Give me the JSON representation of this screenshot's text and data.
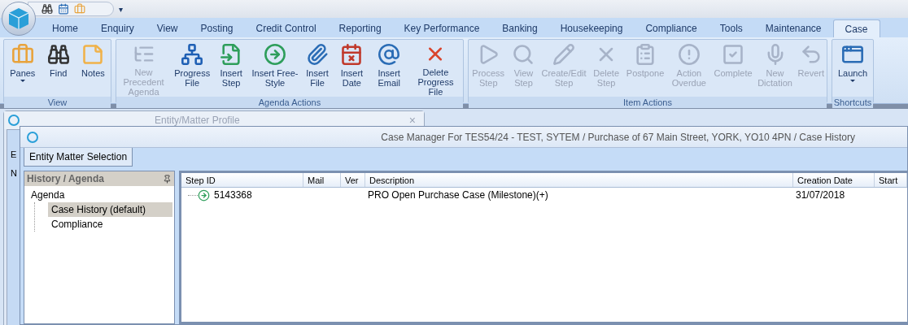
{
  "quick_access": {
    "menu_glyph": "▾"
  },
  "tabs": [
    {
      "label": "Home",
      "selected": false
    },
    {
      "label": "Enquiry",
      "selected": false
    },
    {
      "label": "View",
      "selected": false
    },
    {
      "label": "Posting",
      "selected": false
    },
    {
      "label": "Credit Control",
      "selected": false
    },
    {
      "label": "Reporting",
      "selected": false
    },
    {
      "label": "Key Performance",
      "selected": false
    },
    {
      "label": "Banking",
      "selected": false
    },
    {
      "label": "Housekeeping",
      "selected": false
    },
    {
      "label": "Compliance",
      "selected": false
    },
    {
      "label": "Tools",
      "selected": false
    },
    {
      "label": "Maintenance",
      "selected": false
    },
    {
      "label": "Case",
      "selected": true
    }
  ],
  "ribbon_groups": [
    {
      "title": "View",
      "buttons": [
        {
          "label": "Panes",
          "disabled": false,
          "dropdown": true
        },
        {
          "label": "Find",
          "disabled": false,
          "dropdown": false
        },
        {
          "label": "Notes",
          "disabled": false,
          "dropdown": false
        }
      ]
    },
    {
      "title": "Agenda Actions",
      "buttons": [
        {
          "label": "New Precedent Agenda",
          "disabled": true,
          "dropdown": false
        },
        {
          "label": "Progress File",
          "disabled": false,
          "dropdown": false
        },
        {
          "label": "Insert Step",
          "disabled": false,
          "dropdown": false
        },
        {
          "label": "Insert Free-Style",
          "disabled": false,
          "dropdown": false
        },
        {
          "label": "Insert File",
          "disabled": false,
          "dropdown": false
        },
        {
          "label": "Insert Date",
          "disabled": false,
          "dropdown": false
        },
        {
          "label": "Insert Email",
          "disabled": false,
          "dropdown": false
        },
        {
          "label": "Delete Progress File",
          "disabled": false,
          "dropdown": false
        }
      ]
    },
    {
      "title": "Item Actions",
      "buttons": [
        {
          "label": "Process Step",
          "disabled": true,
          "dropdown": false
        },
        {
          "label": "View Step",
          "disabled": true,
          "dropdown": false
        },
        {
          "label": "Create/Edit Step",
          "disabled": true,
          "dropdown": false
        },
        {
          "label": "Delete Step",
          "disabled": true,
          "dropdown": false
        },
        {
          "label": "Postpone",
          "disabled": true,
          "dropdown": false
        },
        {
          "label": "Action Overdue",
          "disabled": true,
          "dropdown": false
        },
        {
          "label": "Complete",
          "disabled": true,
          "dropdown": false
        },
        {
          "label": "New Dictation",
          "disabled": true,
          "dropdown": false
        },
        {
          "label": "Revert",
          "disabled": true,
          "dropdown": false
        }
      ]
    },
    {
      "title": "Shortcuts",
      "buttons": [
        {
          "label": "Launch",
          "disabled": false,
          "dropdown": true
        }
      ]
    }
  ],
  "background_window": {
    "title": "Entity/Matter Profile",
    "close_glyph": "×",
    "labels": [
      "E",
      "N"
    ]
  },
  "case_window": {
    "title": "Case Manager For TES54/24 - TEST, SYTEM / Purchase of 67 Main Street, YORK, YO10 4PN / Case History",
    "toolbar_button": "Entity Matter Selection",
    "pane": {
      "title": "History / Agenda",
      "tree": [
        {
          "label": "Agenda",
          "selected": false,
          "children": [
            {
              "label": "Case History (default)",
              "selected": true
            },
            {
              "label": "Compliance",
              "selected": false
            }
          ]
        }
      ]
    },
    "table": {
      "columns": [
        "Step ID",
        "Mail",
        "Ver",
        "Description",
        "Creation Date",
        "Start"
      ],
      "rows": [
        {
          "step_id": "5143368",
          "mail": "",
          "ver": "",
          "description": "PRO Open Purchase Case (Milestone)(+)",
          "creation_date": "31/07/2018",
          "selected": false
        }
      ]
    }
  }
}
